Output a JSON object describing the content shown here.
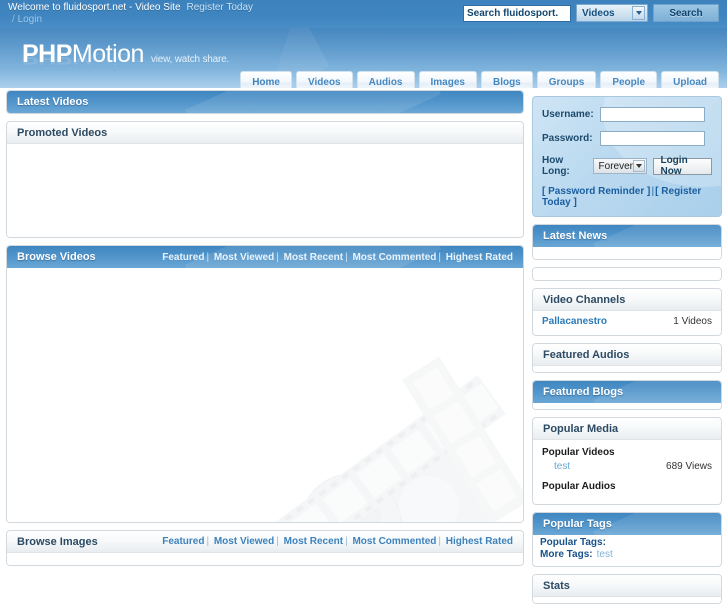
{
  "topbar": {
    "welcome": "Welcome  to fluidosport.net - Video Site",
    "register": "Register Today",
    "slash": "/",
    "login": "Login",
    "search_value": "Search fluidosport.",
    "search_placeholder": "Search fluidosport.net",
    "search_scope": "Videos",
    "search_button": "Search"
  },
  "header": {
    "logo_bold": "PHP",
    "logo_light": "Motion",
    "tagline": "view, watch share.",
    "nav": [
      {
        "label": "Home"
      },
      {
        "label": "Videos"
      },
      {
        "label": "Audios"
      },
      {
        "label": "Images"
      },
      {
        "label": "Blogs"
      },
      {
        "label": "Groups"
      },
      {
        "label": "People"
      },
      {
        "label": "Upload"
      }
    ]
  },
  "filters": {
    "featured": "Featured",
    "most_viewed": "Most Viewed",
    "most_recent": "Most Recent",
    "most_commented": "Most Commented",
    "highest_rated": "Highest Rated",
    "separator": "|"
  },
  "main": {
    "latest_videos_title": "Latest Videos",
    "promoted_videos_title": "Promoted Videos",
    "browse_videos_title": "Browse Videos",
    "browse_images_title": "Browse Images"
  },
  "sidebar": {
    "login": {
      "username_label": "Username:",
      "username_value": "",
      "password_label": "Password:",
      "password_value": "",
      "howlong_label": "How Long:",
      "howlong_value": "Forever",
      "login_button": "Login Now",
      "password_reminder": "[ Password Reminder ]",
      "pipe": "|",
      "register_today": "[ Register Today ]"
    },
    "latest_news_title": "Latest News",
    "video_channels_title": "Video Channels",
    "channels": [
      {
        "name": "Pallacanestro",
        "count": "1 Videos"
      }
    ],
    "featured_audios_title": "Featured Audios",
    "featured_blogs_title": "Featured Blogs",
    "popular_media_title": "Popular Media",
    "popular_videos_label": "Popular Videos",
    "popular_videos": [
      {
        "title": "test",
        "views": "689 Views"
      }
    ],
    "popular_audios_label": "Popular Audios",
    "popular_tags_title": "Popular Tags",
    "popular_tags_label": "Popular Tags:",
    "popular_tags_value": "",
    "more_tags_label": "More Tags:",
    "more_tags_value": "test",
    "stats_title": "Stats"
  },
  "colors": {
    "brand_blue": "#3d82bd",
    "link_blue": "#2a7ab8",
    "panel_border": "#d2d9de",
    "bar_blue_top": "#3f86c1",
    "bar_blue_bottom": "#6aa7d5"
  }
}
